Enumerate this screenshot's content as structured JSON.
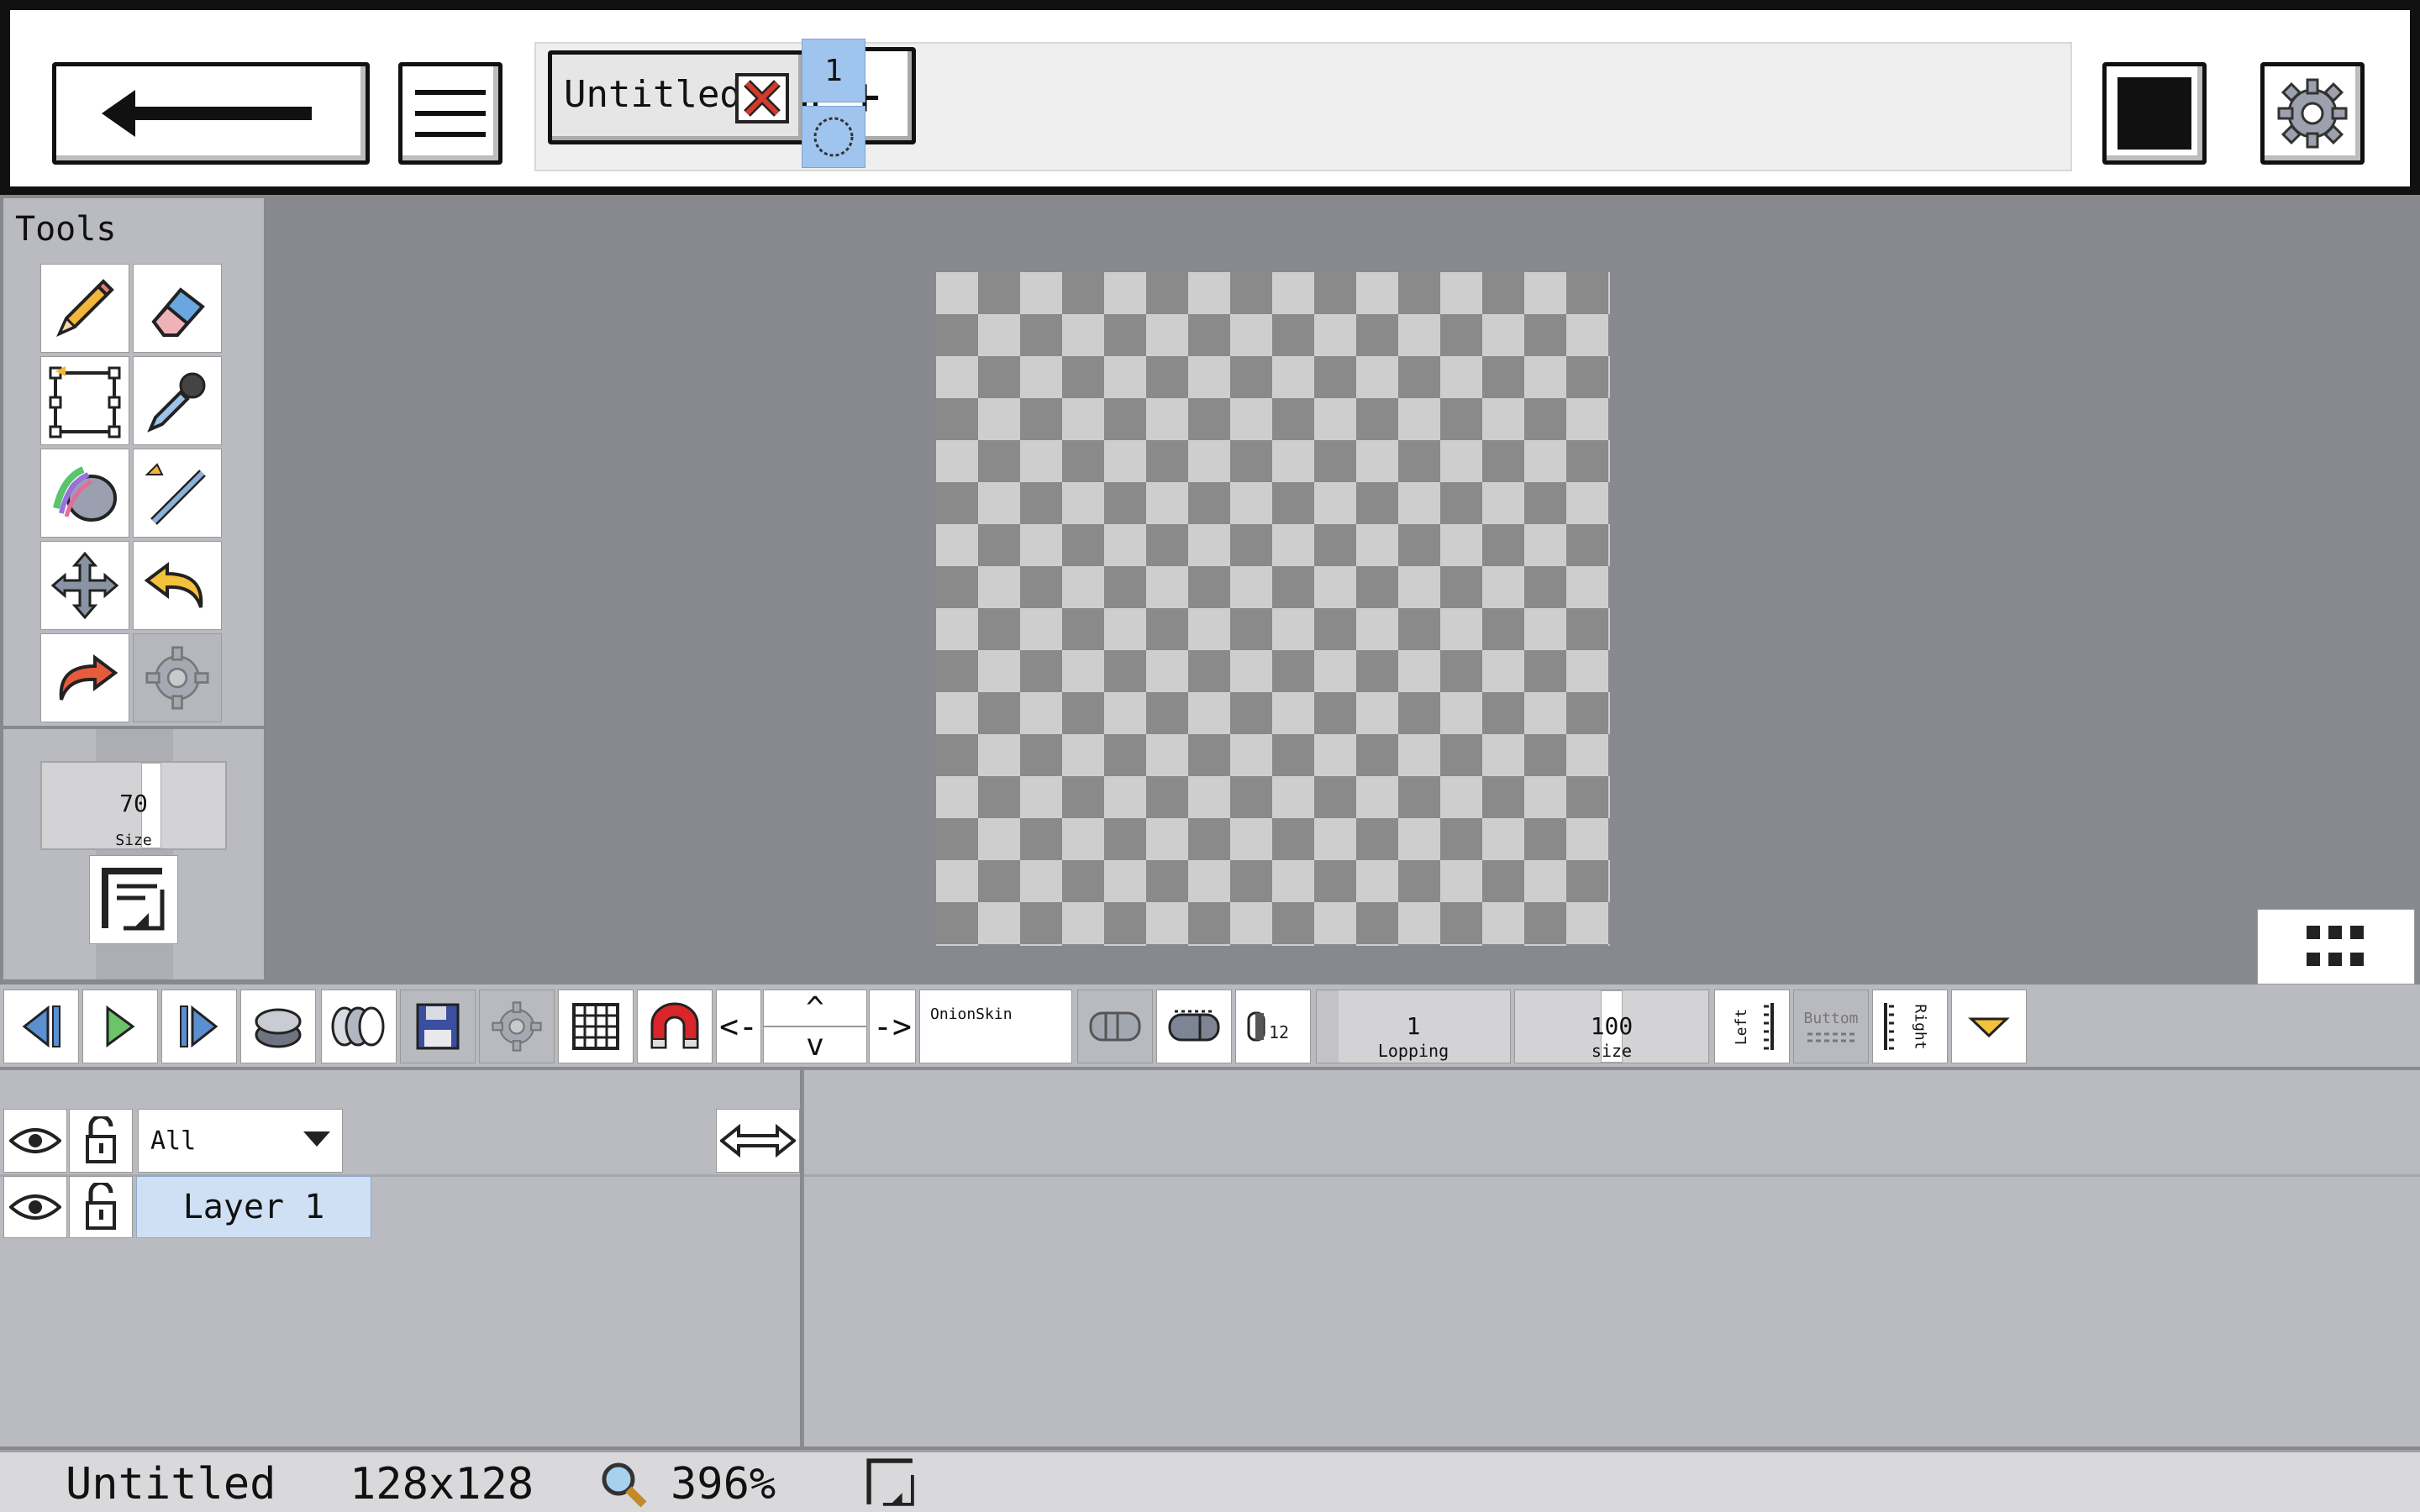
{
  "topbar": {
    "back_icon": "left-arrow-icon",
    "menu_icon": "hamburger-menu-icon",
    "tabs": [
      {
        "label": "Untitled",
        "close_icon": "close-x-icon"
      }
    ],
    "new_tab_label": "+",
    "color_swatch": "#111111",
    "settings_icon": "gear-icon"
  },
  "tools": {
    "title": "Tools",
    "items": [
      {
        "name": "pencil",
        "icon": "pencil-icon"
      },
      {
        "name": "eraser",
        "icon": "eraser-icon"
      },
      {
        "name": "select",
        "icon": "selection-icon"
      },
      {
        "name": "eyedropper",
        "icon": "eyedropper-icon"
      },
      {
        "name": "fill",
        "icon": "bucket-icon"
      },
      {
        "name": "line",
        "icon": "line-icon"
      },
      {
        "name": "move",
        "icon": "move-icon"
      },
      {
        "name": "undo",
        "icon": "undo-icon"
      },
      {
        "name": "redo",
        "icon": "redo-icon"
      },
      {
        "name": "settings",
        "icon": "gear-icon",
        "disabled": true
      }
    ],
    "brush_size": {
      "value": "70",
      "label": "Size",
      "fraction": 0.7
    },
    "resize_icon": "resize-corner-icon"
  },
  "canvas": {
    "grid_toggle_icon": "dots-grid-icon"
  },
  "animation": {
    "prev_frame_icon": "prev-frame-icon",
    "play_icon": "play-icon",
    "next_frame_icon": "next-frame-icon",
    "layers_icon": "layers-stack-icon",
    "onion_icon": "onion-skin-icon",
    "save_icon": "floppy-disk-icon",
    "gear_icon": "gear-icon",
    "grid_icon": "grid-icon",
    "magnet_icon": "magnet-icon",
    "nav_left": "<-",
    "nav_up": "^",
    "nav_down": "v",
    "nav_right": "->",
    "onion_label": "OnionSkin",
    "looping": {
      "value": "1",
      "label": "Lopping"
    },
    "size": {
      "value": "100",
      "label": "size"
    },
    "left_label": "Left",
    "bottom_label": "Buttom",
    "right_label": "Right"
  },
  "layers": {
    "filter_value": "All",
    "items": [
      {
        "name": "Layer 1"
      }
    ],
    "frame_number": "1"
  },
  "status": {
    "filename": "Untitled",
    "dimensions": "128x128",
    "zoom": "396%"
  }
}
